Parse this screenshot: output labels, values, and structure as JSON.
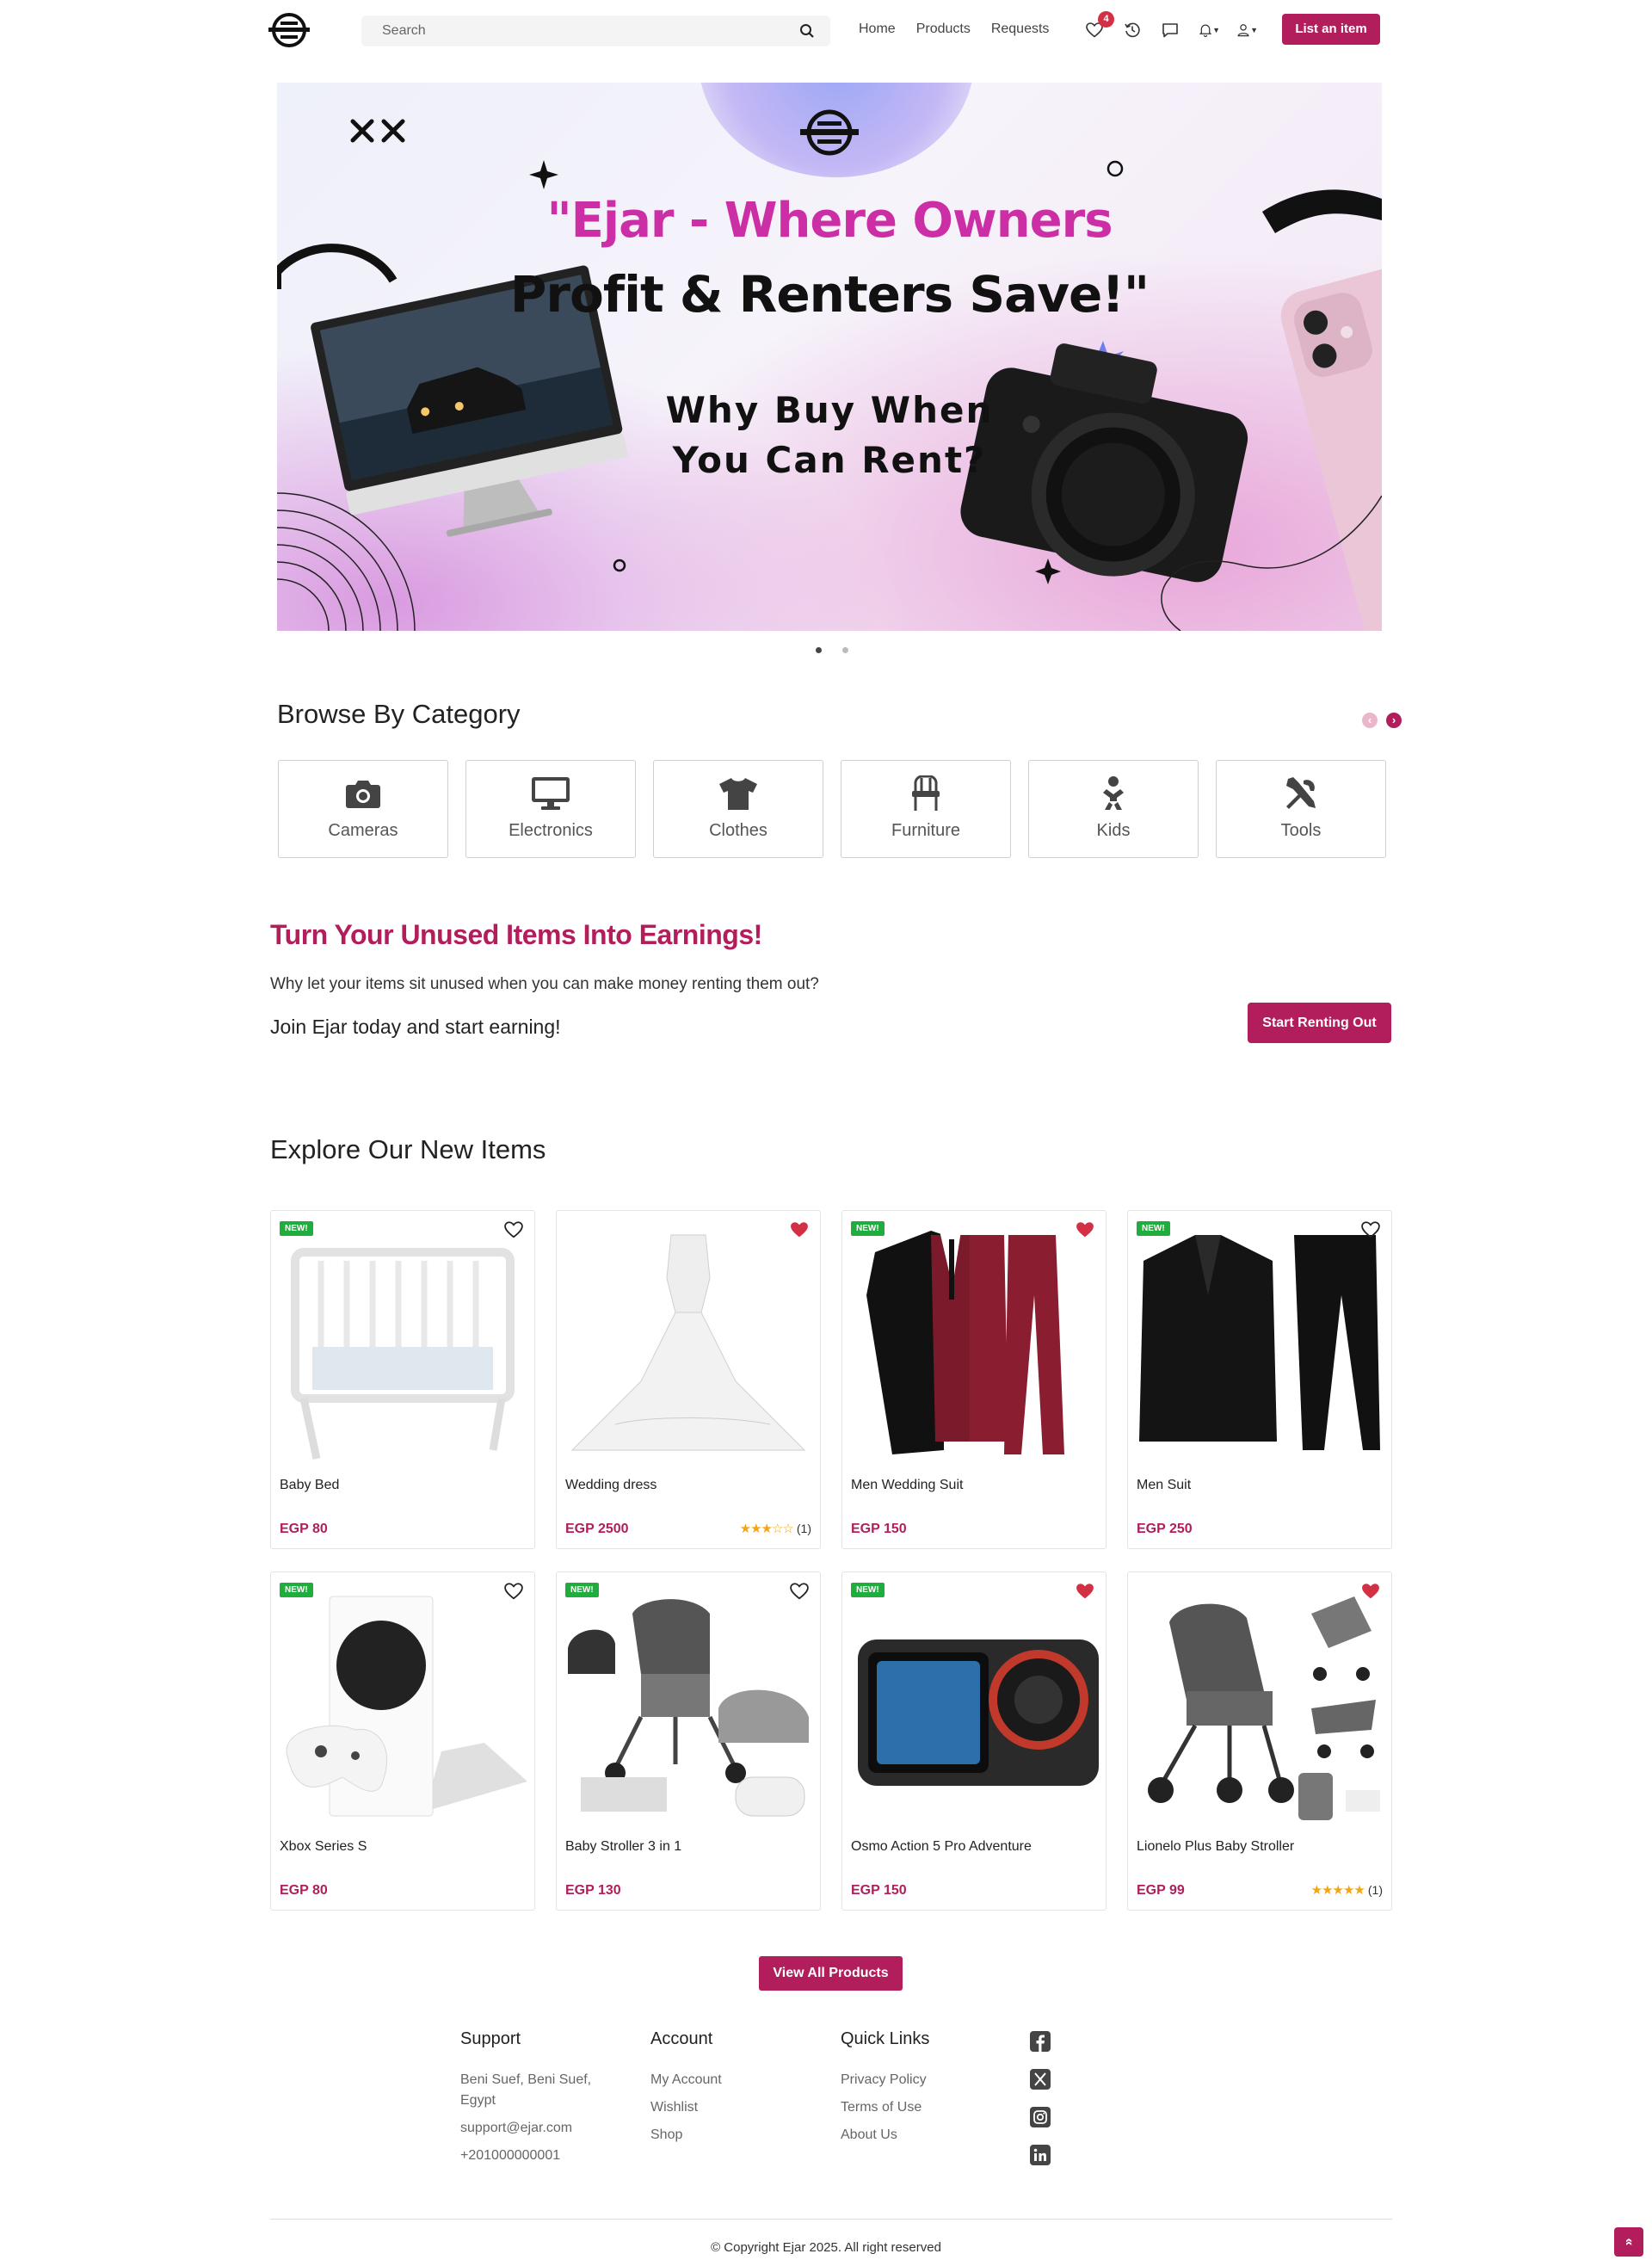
{
  "nav": {
    "search_placeholder": "Search",
    "links": [
      "Home",
      "Products",
      "Requests"
    ],
    "wishlist_count": "4",
    "list_button": "List an item"
  },
  "hero": {
    "line1": "\"Ejar - Where Owners",
    "line2": "Profit & Renters Save!\"",
    "line3a": "Why Buy When",
    "line3b": "You Can Rent?",
    "slides": 2,
    "active_slide": 1
  },
  "categories": {
    "title": "Browse By Category",
    "items": [
      {
        "label": "Cameras",
        "icon": "camera-icon"
      },
      {
        "label": "Electronics",
        "icon": "monitor-icon"
      },
      {
        "label": "Clothes",
        "icon": "tshirt-icon"
      },
      {
        "label": "Furniture",
        "icon": "chair-icon"
      },
      {
        "label": "Kids",
        "icon": "baby-icon"
      },
      {
        "label": "Tools",
        "icon": "tools-icon"
      }
    ]
  },
  "cta": {
    "title": "Turn Your Unused Items Into Earnings!",
    "subtitle": "Why let your items sit unused when you can make money renting them out?",
    "join": "Join Ejar today and start earning!",
    "button": "Start Renting Out"
  },
  "new_items": {
    "title": "Explore Our New Items",
    "badge_label": "NEW!",
    "products": [
      {
        "name": "Baby Bed",
        "price": "EGP 80",
        "new": true,
        "favorited": false,
        "rating": null,
        "reviews": null
      },
      {
        "name": "Wedding dress",
        "price": "EGP 2500",
        "new": false,
        "favorited": true,
        "rating": 3,
        "reviews": "(1)"
      },
      {
        "name": "Men Wedding Suit",
        "price": "EGP 150",
        "new": true,
        "favorited": true,
        "rating": null,
        "reviews": null
      },
      {
        "name": "Men Suit",
        "price": "EGP 250",
        "new": true,
        "favorited": false,
        "rating": null,
        "reviews": null
      },
      {
        "name": "Xbox Series S",
        "price": "EGP 80",
        "new": true,
        "favorited": false,
        "rating": null,
        "reviews": null
      },
      {
        "name": "Baby Stroller 3 in 1",
        "price": "EGP 130",
        "new": true,
        "favorited": false,
        "rating": null,
        "reviews": null
      },
      {
        "name": "Osmo Action 5 Pro Adventure",
        "price": "EGP 150",
        "new": true,
        "favorited": true,
        "rating": null,
        "reviews": null
      },
      {
        "name": "Lionelo Plus Baby Stroller",
        "price": "EGP 99",
        "new": false,
        "favorited": true,
        "rating": 5,
        "reviews": "(1)"
      }
    ],
    "view_all": "View All Products"
  },
  "footer": {
    "support": {
      "title": "Support",
      "address": "Beni Suef, Beni Suef, Egypt",
      "email": "support@ejar.com",
      "phone": "+201000000001"
    },
    "account": {
      "title": "Account",
      "links": [
        "My Account",
        "Wishlist",
        "Shop"
      ]
    },
    "quick": {
      "title": "Quick Links",
      "links": [
        "Privacy Policy",
        "Terms of Use",
        "About Us"
      ]
    },
    "social": [
      "facebook-icon",
      "x-icon",
      "instagram-icon",
      "linkedin-icon"
    ],
    "copyright": "© Copyright Ejar 2025. All right reserved"
  },
  "colors": {
    "brand": "#b21e5c",
    "new_badge": "#1fae3d",
    "heart": "#d32f45",
    "star": "#f2a516"
  }
}
